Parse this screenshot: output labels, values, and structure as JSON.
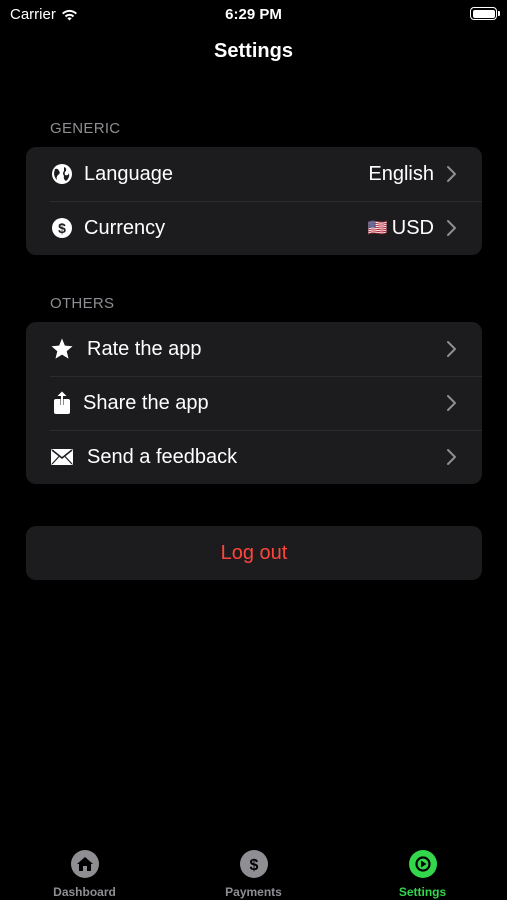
{
  "status_bar": {
    "carrier": "Carrier",
    "time": "6:29 PM"
  },
  "nav": {
    "title": "Settings"
  },
  "generic": {
    "header": "GENERIC",
    "items": [
      {
        "label": "Language",
        "value": "English",
        "icon": "globe-icon"
      },
      {
        "label": "Currency",
        "value": "USD",
        "flag": "🇺🇸",
        "icon": "dollar-icon"
      }
    ]
  },
  "others": {
    "header": "OTHERS",
    "items": [
      {
        "label": "Rate the app",
        "icon": "star-icon"
      },
      {
        "label": "Share the app",
        "icon": "share-icon"
      },
      {
        "label": "Send a feedback",
        "icon": "envelope-icon"
      }
    ]
  },
  "logout_label": "Log out",
  "tabs": [
    {
      "label": "Dashboard",
      "icon": "home-icon",
      "active": false
    },
    {
      "label": "Payments",
      "icon": "dollar-icon",
      "active": false
    },
    {
      "label": "Settings",
      "icon": "settings-icon",
      "active": true
    }
  ],
  "colors": {
    "accent": "#32d74b",
    "destructive": "#ff453a",
    "cell": "#1c1c1e",
    "background": "#000000"
  }
}
